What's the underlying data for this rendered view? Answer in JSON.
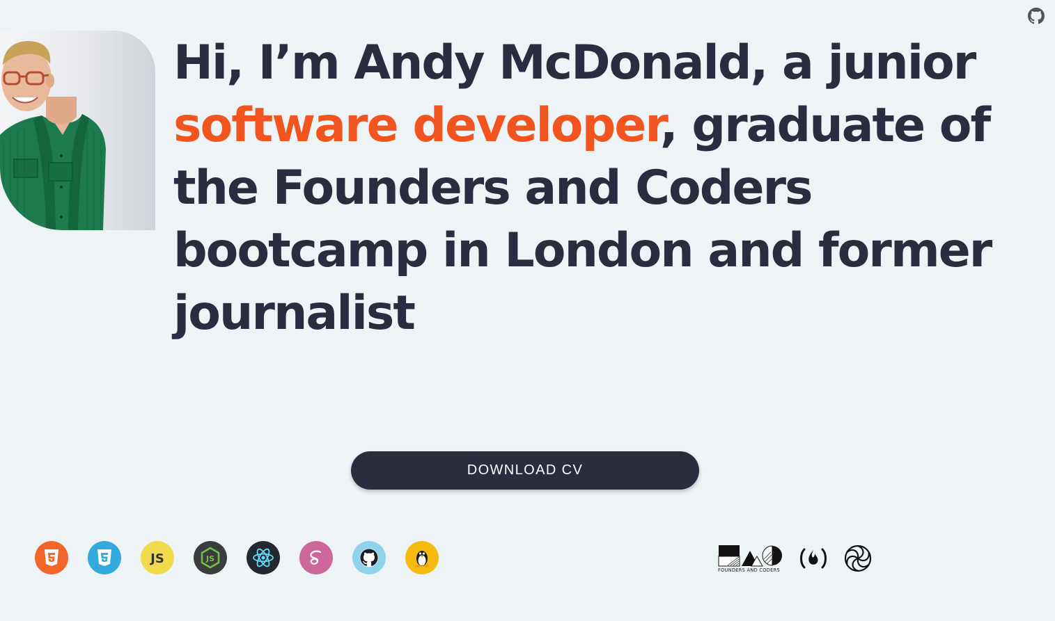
{
  "github_link": {
    "icon": "github-icon"
  },
  "profile": {
    "photo": "profile-photo"
  },
  "intro": {
    "line1": "Hi, I’m Andy McDonald, a junior",
    "highlight": "software developer",
    "line2_rest": ", graduate of",
    "line3": "the Founders and Coders",
    "line4": "bootcamp in London and former",
    "line5": "journalist"
  },
  "cta": {
    "download_label": "DOWNLOAD CV"
  },
  "tech_icons": [
    "html5-icon",
    "css3-icon",
    "javascript-icon",
    "nodejs-icon",
    "react-icon",
    "sass-icon",
    "github-icon",
    "linux-icon"
  ],
  "org_logos": {
    "founders_coders_caption": "FOUNDERS AND CODERS",
    "founders_coders_icon": "founders-and-coders-logo",
    "freecodecamp_icon": "freecodecamp-logo",
    "spiral_icon": "spiral-logo"
  },
  "colors": {
    "background": "#eef3f5",
    "text": "#2a2c40",
    "accent": "#f1541f",
    "button": "#2a2c40"
  }
}
